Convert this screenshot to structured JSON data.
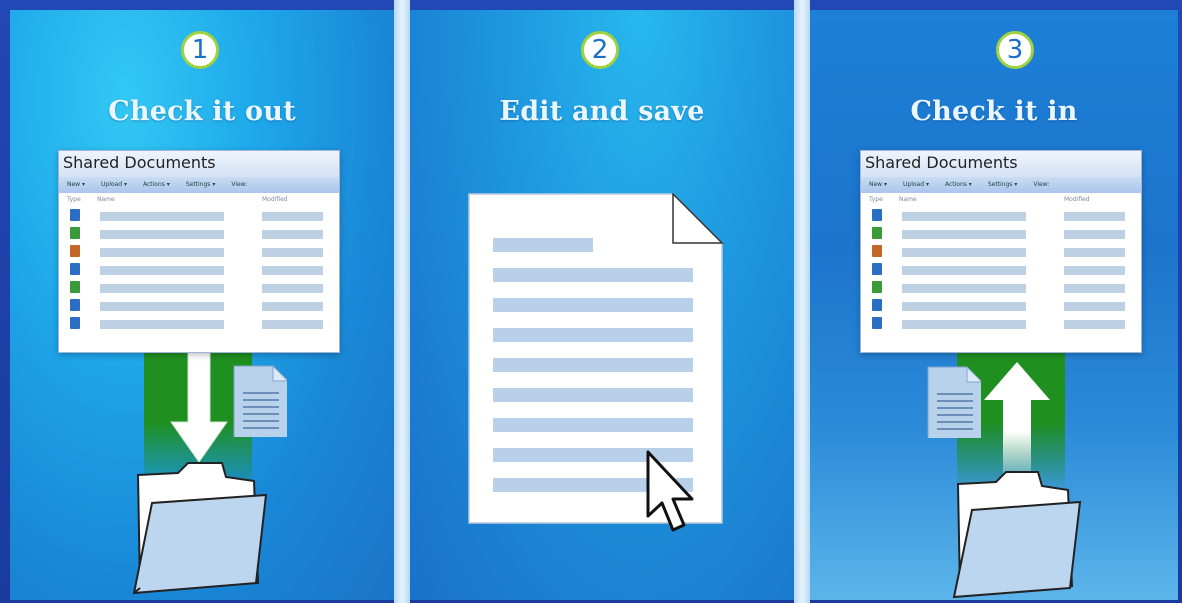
{
  "steps": [
    {
      "number": "1",
      "title": "Check it out"
    },
    {
      "number": "2",
      "title": "Edit and save"
    },
    {
      "number": "3",
      "title": "Check it in"
    }
  ],
  "library": {
    "heading": "Shared Documents",
    "toolbar": [
      "New ▾",
      "Upload ▾",
      "Actions ▾",
      "Settings ▾",
      "View:"
    ],
    "col_type": "Type",
    "col_name": "Name",
    "col_modified": "Modified",
    "row_icon_colors": [
      "#2a6fc4",
      "#3a9a3a",
      "#c4662a",
      "#2a6fc4",
      "#3a9a3a",
      "#2a6fc4",
      "#2a6fc4"
    ]
  },
  "colors": {
    "accent_green": "#1f8f1f",
    "number_ring": "#9fd140",
    "doc_line": "#b8d0ea"
  }
}
